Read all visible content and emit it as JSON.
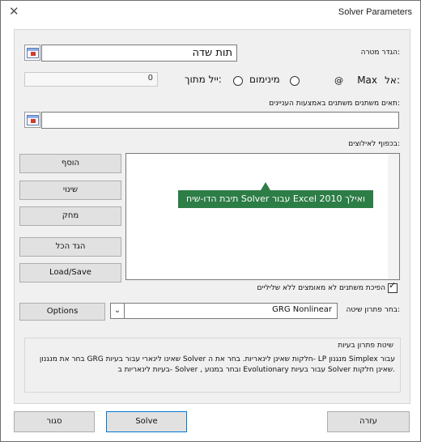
{
  "window": {
    "title": "Solver Parameters",
    "close_glyph": "✕"
  },
  "objective": {
    "label": "הגדר מטרה:",
    "value": "תות שדה"
  },
  "to": {
    "label": "אל:",
    "options": [
      {
        "label": "Max",
        "selected": true
      },
      {
        "label": "מינימום",
        "selected": false
      },
      {
        "label": "ייל מתוך:",
        "selected": false
      }
    ],
    "value_of": "0"
  },
  "variable_cells": {
    "label": "תאים משתנים משתנים באמצעות העניינים:",
    "value": ""
  },
  "constraints": {
    "label": "בכפוף לאילוצים:",
    "items": [],
    "tooltip": "תיבת הדו-שיח Solver עבור Excel 2010 ואילך"
  },
  "side_buttons": {
    "add": "הוסף",
    "change": "שינוי",
    "delete": "מחק",
    "reset_all": "הגד הכל",
    "load_save": "Load/Save"
  },
  "non_negative": {
    "label": "הפיכת משתנים לא מאומצים ללא שליליים",
    "checked": true
  },
  "solving_method": {
    "label": "בחר פתרון שיטה:",
    "selected": "GRG Nonlinear",
    "options_button": "Options"
  },
  "method_group": {
    "title": "שיטת פתרון בעיות",
    "description": "בחר את מנגנון GRG שאינו לינארי עבור בעיות Solver חלקות שאינן לינאריות. בחר את ה- LP מנגנון Simplex עבור בעיות לינאריות ב- Solver , ובחר במנוע Evolutionary עבור בעיות Solver שאינן חלקות."
  },
  "bottom_buttons": {
    "help": "עזרה",
    "solve": "Solve",
    "close": "סגור"
  },
  "colors": {
    "tooltip_bg": "#2d7d46",
    "button_bg": "#e1e1e1",
    "panel_bg": "#f0f0f0"
  }
}
